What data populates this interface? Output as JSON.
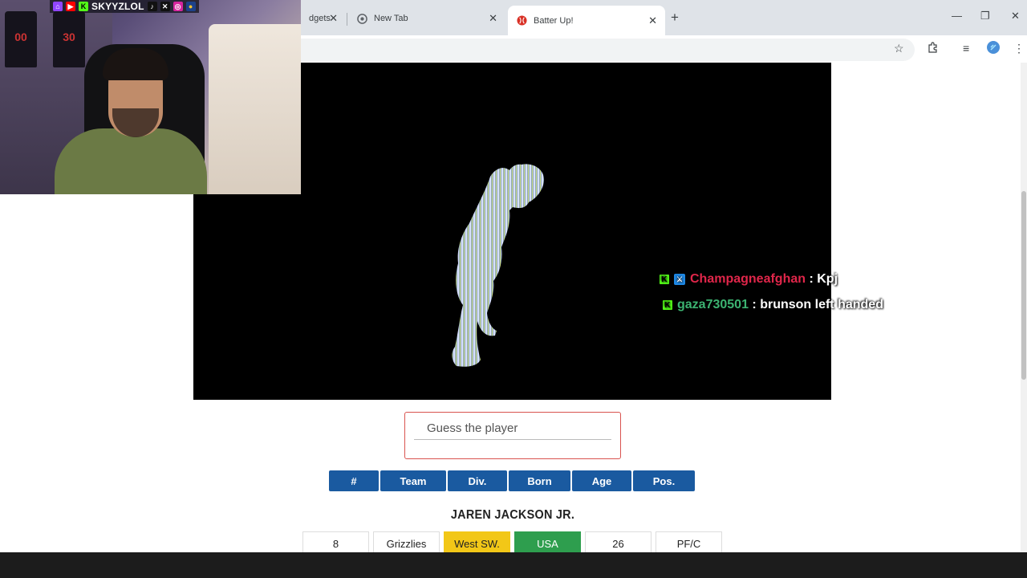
{
  "browser": {
    "tabs": [
      {
        "label": "dgets",
        "active": false
      },
      {
        "label": "New Tab",
        "active": false
      },
      {
        "label": "Batter Up!",
        "active": true
      }
    ],
    "new_tab_icon": "plus-icon",
    "window_controls": [
      "minimize-icon",
      "restore-icon",
      "close-icon"
    ],
    "toolbar_icons": [
      "star-icon",
      "extensions-icon",
      "media-icon",
      "profile-icon",
      "menu-icon"
    ]
  },
  "game": {
    "guess_placeholder": "Guess the player",
    "headers": [
      "#",
      "Team",
      "Div.",
      "Born",
      "Age",
      "Pos."
    ],
    "guess_row": {
      "player_name": "JAREN JACKSON JR.",
      "cells": [
        {
          "value": "8",
          "status": "neutral"
        },
        {
          "value": "Grizzlies",
          "status": "neutral"
        },
        {
          "value": "West SW.",
          "status": "partial",
          "color": "#f2c717"
        },
        {
          "value": "USA",
          "status": "correct",
          "color": "#2e9e4e"
        },
        {
          "value": "26",
          "status": "neutral"
        },
        {
          "value": "PF/C",
          "status": "neutral"
        }
      ]
    }
  },
  "stream_overlay": {
    "streamer_name": "SKYYZLOL",
    "social_icons": [
      "twitch-icon",
      "youtube-icon",
      "kick-icon",
      "tiktok-icon",
      "x-icon",
      "instagram-icon"
    ],
    "webcam_jerseys": [
      "00",
      "30"
    ],
    "chat": [
      {
        "user": "Champagneafghan",
        "user_color": "#e0264a",
        "message": "Kpj",
        "badges": [
          "kick-icon",
          "moderator-icon"
        ]
      },
      {
        "user": "gaza730501",
        "user_color": "#3cb371",
        "message": "brunson left handed",
        "badges": [
          "kick-icon"
        ]
      }
    ]
  },
  "colors": {
    "header_blue": "#1a5aa0",
    "guess_border": "#d9534f",
    "partial_yellow": "#f2c717",
    "correct_green": "#2e9e4e"
  }
}
